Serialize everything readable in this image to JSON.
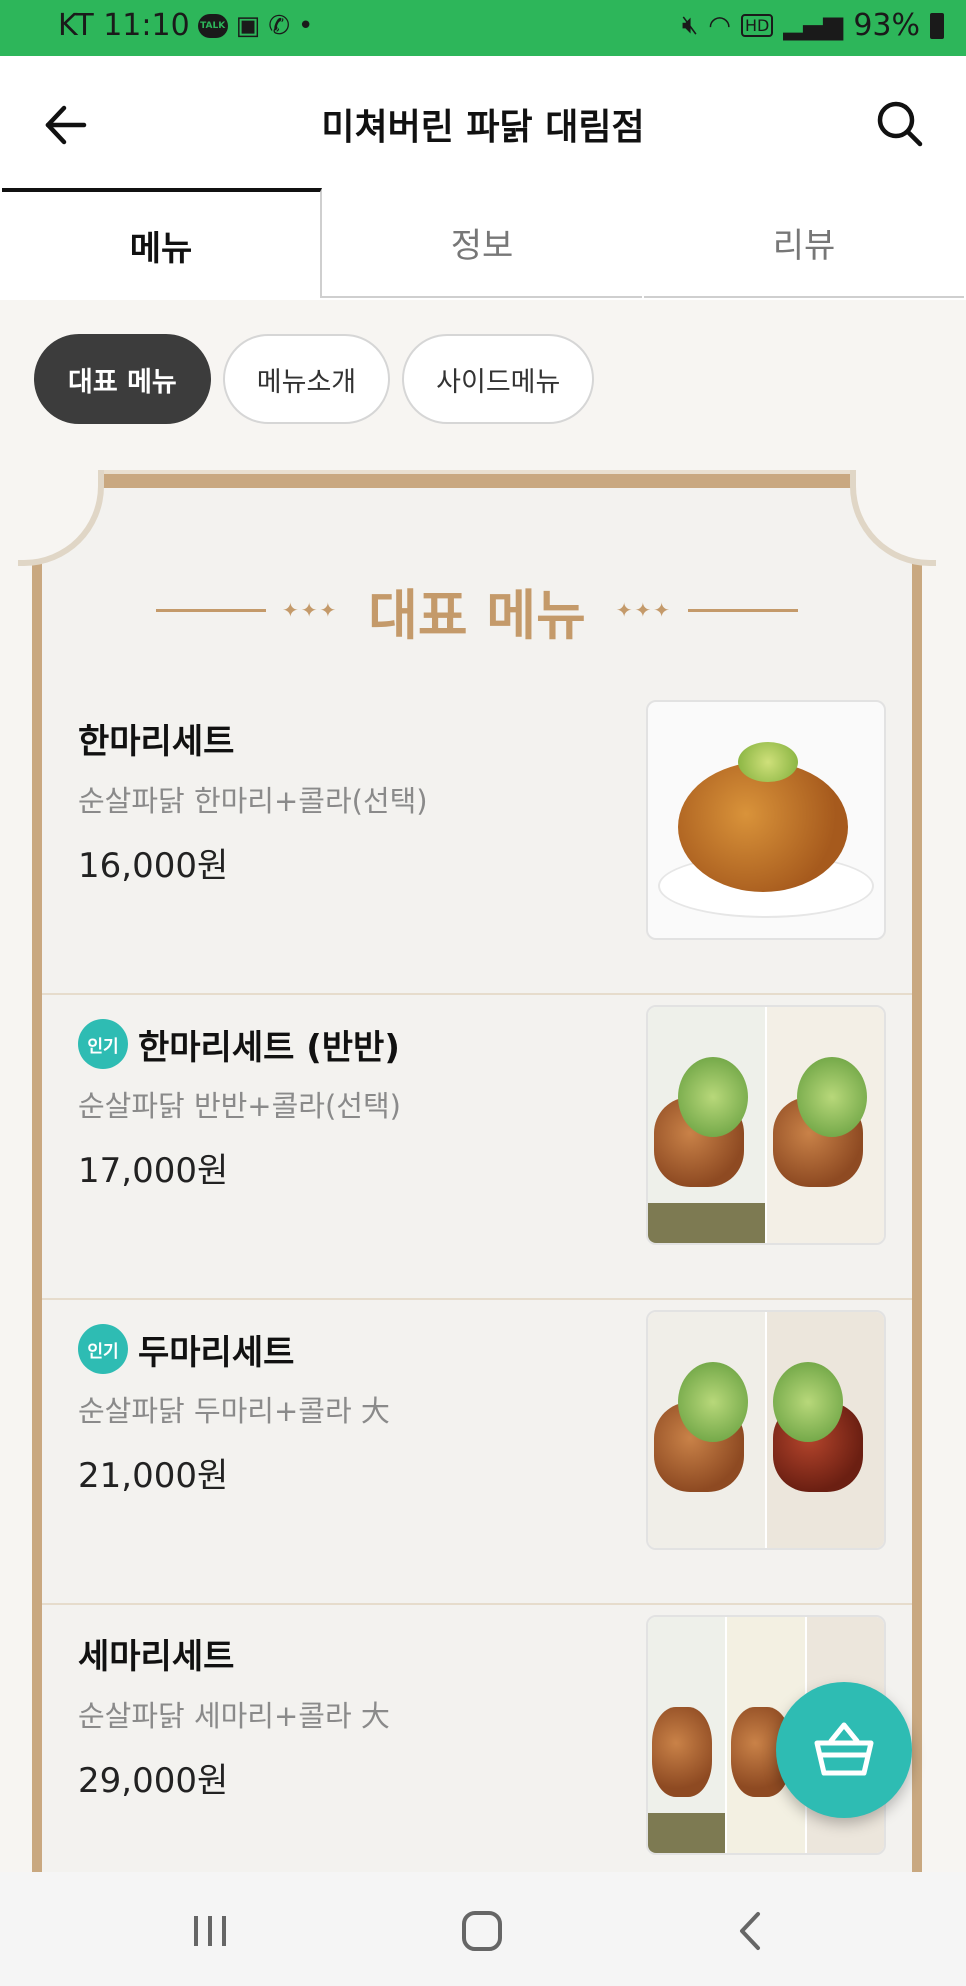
{
  "status_bar": {
    "carrier_time": "KT 11:10",
    "talk_label": "TALK",
    "dot": "•",
    "battery": "93%",
    "icons": [
      "talk-icon",
      "image-icon",
      "phone-icon",
      "mute-icon",
      "wifi-icon",
      "hd-icon",
      "signal-icon",
      "battery-icon"
    ]
  },
  "header": {
    "title": "미쳐버린 파닭 대림점",
    "back_icon": "arrow-left-icon",
    "search_icon": "search-icon"
  },
  "tabs": [
    {
      "label": "메뉴",
      "active": true
    },
    {
      "label": "정보",
      "active": false
    },
    {
      "label": "리뷰",
      "active": false
    }
  ],
  "chips": [
    {
      "label": "대표 메뉴",
      "active": true
    },
    {
      "label": "메뉴소개",
      "active": false
    },
    {
      "label": "사이드메뉴",
      "active": false
    }
  ],
  "section": {
    "heading": "대표 메뉴",
    "deco_left": "✦✦✦",
    "deco_right": "✦✦✦"
  },
  "menu_items": [
    {
      "name": "한마리세트",
      "badge": "",
      "desc": "순살파닭 한마리+콜라(선택)",
      "price": "16,000원"
    },
    {
      "name": "한마리세트 (반반)",
      "badge": "인기",
      "desc": "순살파닭 반반+콜라(선택)",
      "price": "17,000원"
    },
    {
      "name": "두마리세트",
      "badge": "인기",
      "desc": "순살파닭 두마리+콜라 大",
      "price": "21,000원"
    },
    {
      "name": "세마리세트",
      "badge": "",
      "desc": "순살파닭 세마리+콜라 大",
      "price": "29,000원"
    }
  ],
  "colors": {
    "status_bar": "#2db65a",
    "accent_teal": "#2ebcb3",
    "frame_gold": "#c9a880",
    "chip_active": "#3c3c3c"
  },
  "cart_icon": "basket-icon",
  "nav": [
    "recent-apps-icon",
    "home-icon",
    "back-icon"
  ]
}
